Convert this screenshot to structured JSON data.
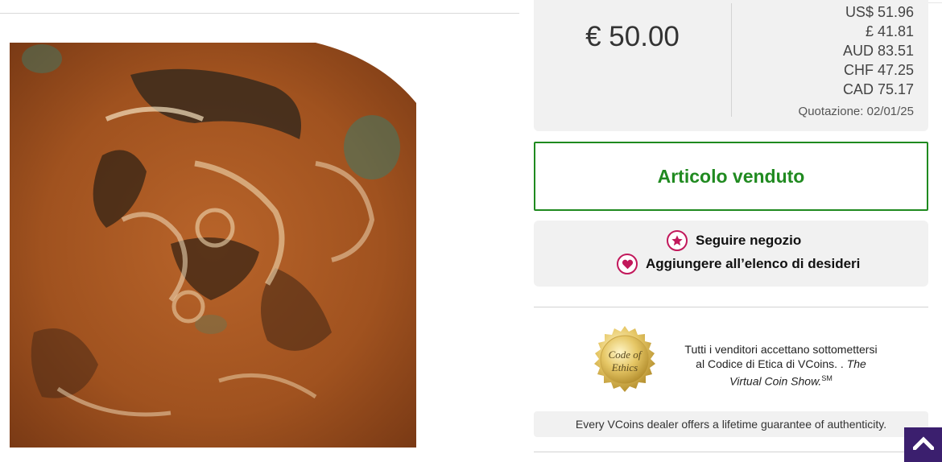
{
  "price": {
    "main": "€ 50.00",
    "conversions": [
      "US$ 51.96",
      "£ 41.81",
      "AUD 83.51",
      "CHF 47.25",
      "CAD 75.17"
    ],
    "quote_date": "Quotazione: 02/01/25"
  },
  "status": {
    "sold_label": "Articolo venduto"
  },
  "actions": {
    "follow_label": "Seguire negozio",
    "wishlist_label": "Aggiungere all’elenco di desideri"
  },
  "ethics": {
    "seal_line1": "Code of",
    "seal_line2": "Ethics",
    "text_main": "Tutti i venditori accettano sottomettersi al Codice di Etica di VCoins. . ",
    "text_italic": "The Virtual Coin Show.",
    "text_sup": "SM"
  },
  "guarantee": {
    "text": "Every VCoins dealer offers a lifetime guarantee of authenticity."
  },
  "icons": {
    "follow": "star-icon",
    "wishlist": "heart-icon",
    "scroll_top": "chevron-up-icon"
  },
  "colors": {
    "sold_green": "#208a20",
    "accent_pink": "#c2185b",
    "scroll_button": "#3b1f6e",
    "panel_bg": "#f1f1f1"
  }
}
